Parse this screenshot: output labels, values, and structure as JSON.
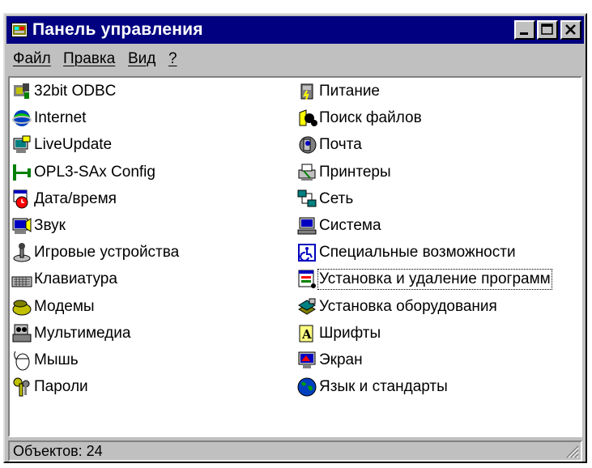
{
  "window": {
    "title": "Панель управления",
    "icon": "control-panel-icon"
  },
  "title_buttons": {
    "minimize": "minimize-icon",
    "maximize": "maximize-icon",
    "close": "close-icon"
  },
  "menu": {
    "items": [
      {
        "label": "Файл"
      },
      {
        "label": "Правка"
      },
      {
        "label": "Вид"
      },
      {
        "label": "?"
      }
    ]
  },
  "items": [
    {
      "label": "32bit ODBC",
      "icon": "odbc-icon"
    },
    {
      "label": "Internet",
      "icon": "internet-icon"
    },
    {
      "label": "LiveUpdate",
      "icon": "liveupdate-icon"
    },
    {
      "label": "OPL3-SAx Config",
      "icon": "audio-config-icon"
    },
    {
      "label": "Дата/время",
      "icon": "calendar-clock-icon"
    },
    {
      "label": "Звук",
      "icon": "sound-icon"
    },
    {
      "label": "Игровые устройства",
      "icon": "joystick-icon"
    },
    {
      "label": "Клавиатура",
      "icon": "keyboard-icon"
    },
    {
      "label": "Модемы",
      "icon": "modem-icon"
    },
    {
      "label": "Мультимедиа",
      "icon": "multimedia-icon"
    },
    {
      "label": "Мышь",
      "icon": "mouse-icon"
    },
    {
      "label": "Пароли",
      "icon": "keys-icon"
    },
    {
      "label": "Питание",
      "icon": "power-icon"
    },
    {
      "label": "Поиск файлов",
      "icon": "find-files-icon"
    },
    {
      "label": "Почта",
      "icon": "mail-icon"
    },
    {
      "label": "Принтеры",
      "icon": "printers-icon"
    },
    {
      "label": "Сеть",
      "icon": "network-icon"
    },
    {
      "label": "Система",
      "icon": "system-icon"
    },
    {
      "label": "Специальные возможности",
      "icon": "accessibility-icon"
    },
    {
      "label": "Установка и удаление программ",
      "icon": "add-remove-programs-icon",
      "focused": true
    },
    {
      "label": "Установка оборудования",
      "icon": "add-hardware-icon"
    },
    {
      "label": "Шрифты",
      "icon": "fonts-icon"
    },
    {
      "label": "Экран",
      "icon": "display-icon"
    },
    {
      "label": "Язык и стандарты",
      "icon": "regional-settings-icon"
    }
  ],
  "status": {
    "text": "Объектов: 24"
  },
  "colors": {
    "titlebar": "#000080",
    "face": "#c0c0c0",
    "list_bg": "#ffffff"
  }
}
